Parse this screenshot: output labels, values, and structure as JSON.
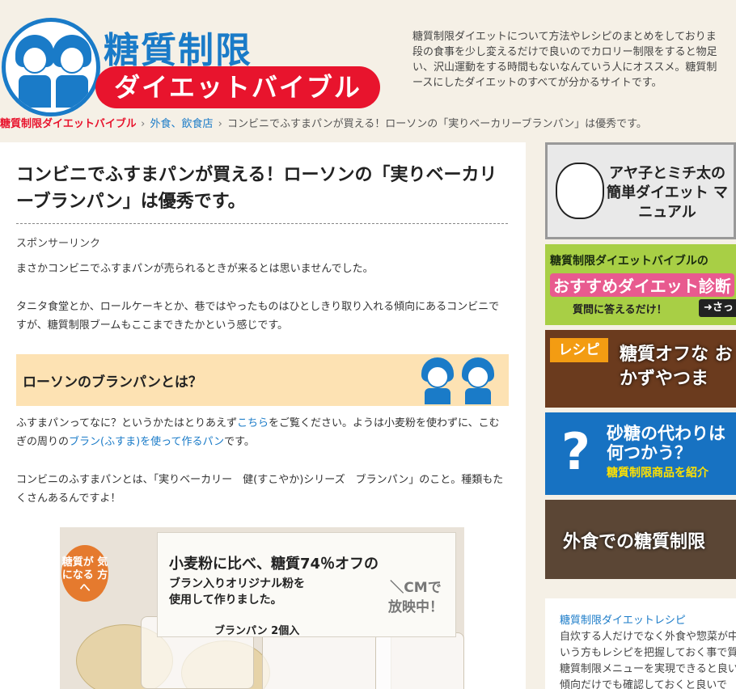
{
  "header": {
    "logo_title": "糖質制限",
    "logo_subtitle": "ダイエットバイブル",
    "site_description": [
      "糖質制限ダイエットについて方法やレシピのまとめをしておりま",
      "段の食事を少し変えるだけで良いのでカロリー制限をすると物足",
      "い、沢山運動をする時間もないなんていう人にオススメ。糖質制",
      "ースにしたダイエットのすべてが分かるサイトです。"
    ]
  },
  "breadcrumb": {
    "home": "糖質制限ダイエットバイブル",
    "category": "外食、飲食店",
    "current": "コンビニでふすまパンが買える！ローソンの「実りベーカリーブランパン」は優秀です。",
    "separator": "›"
  },
  "article": {
    "title": "コンビニでふすまパンが買える！ローソンの「実りベーカリーブランパン」は優秀です。",
    "sponsored": "スポンサーリンク",
    "p1": "まさかコンビニでふすまパンが売られるときが来るとは思いませんでした。",
    "p2": "タニタ食堂とか、ロールケーキとか、巷ではやったものはひとしきり取り入れる傾向にあるコンビニですが、糖質制限ブームもここまできたかという感じです。",
    "heading": "ローソンのブランパンとは？",
    "p3_before": "ふすまパンってなに？というかたはとりあえず",
    "p3_link1": "こちら",
    "p3_mid": "をご覧ください。ようは小麦粉を使わずに、こむぎの周りの",
    "p3_link2": "ブラン(ふすま)を使って作るパン",
    "p3_after": "です。",
    "p4": "コンビニのふすまパンとは、「実りベーカリー　健(すこやか)シリーズ　ブランパン」のこと。種類もたくさんあるんですよ！",
    "photo": {
      "line1": "小麦粉に比べ、糖質74％オフの",
      "line2": "ブラン入りオリジナル粉を",
      "line3": "使用して作りました。",
      "cm": "＼CMで 放映中！",
      "pack": "ブランパン 2個入",
      "badge": "糖質が 気になる 方へ"
    }
  },
  "sidebar": {
    "banner1": "アヤ子とミチ太の 簡単ダイエット マニュアル",
    "banner2_top": "糖質制限ダイエットバイブルの",
    "banner2_main": "おすすめダイエット診断",
    "banner2_sub": "質問に答えるだけ！",
    "banner2_btn": "➜さっ",
    "banner3_tag": "レシピ",
    "banner3_text": "糖質オフな おかずやつま",
    "banner4_q": "?",
    "banner4_text": "砂糖の代わりは 何つかう？",
    "banner4_sub": "糖質制限商品を紹介",
    "banner5": "外食での糖質制限",
    "box_title": "糖質制限ダイエットレシピ",
    "box_lines": [
      "自炊する人だけでなく外食や惣菜が中",
      "いう方もレシピを把握しておく事で質",
      "糖質制限メニューを実現できると良い",
      "傾向だけでも確認しておくと良いで"
    ]
  },
  "colors": {
    "brand_blue": "#1a7bc8",
    "brand_red": "#e8142d",
    "background": "#f5f0e6",
    "heading_bg": "#fde2b3"
  }
}
